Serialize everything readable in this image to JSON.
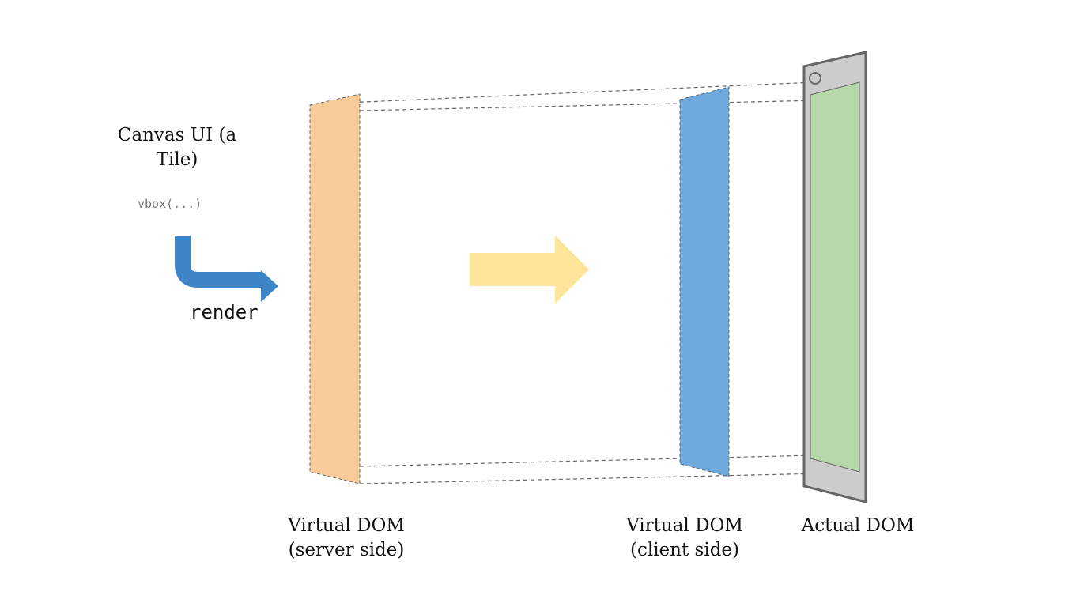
{
  "source": {
    "title": "Canvas UI (a Tile)",
    "code": "vbox(...)",
    "action": "render"
  },
  "layers": [
    {
      "id": "server",
      "title": "Virtual DOM",
      "subtitle": "(server side)",
      "color": "#f8cb9b"
    },
    {
      "id": "client",
      "title": "Virtual DOM",
      "subtitle": "(client side)",
      "color": "#6fa8dc"
    },
    {
      "id": "actual",
      "title": "Actual DOM",
      "subtitle": "",
      "color": "#b6d7a8"
    }
  ],
  "colors": {
    "render_arrow": "#3d85c6",
    "transfer_arrow": "#ffe599",
    "device_frame": "#cccccc",
    "device_border": "#666666",
    "projection_lines": "#666666"
  }
}
